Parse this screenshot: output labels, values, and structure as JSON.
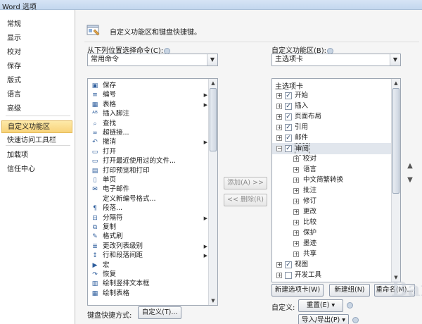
{
  "titlebar": {
    "title": "Word 选项",
    "ghost_left": "",
    "ghost_right": ""
  },
  "nav": {
    "items": [
      {
        "label": "常规"
      },
      {
        "label": "显示"
      },
      {
        "label": "校对"
      },
      {
        "label": "保存"
      },
      {
        "label": "版式"
      },
      {
        "label": "语言"
      },
      {
        "label": "高级"
      },
      {
        "label": "自定义功能区"
      },
      {
        "label": "快速访问工具栏"
      },
      {
        "label": "加载项"
      },
      {
        "label": "信任中心"
      }
    ]
  },
  "header": {
    "text": "自定义功能区和键盘快捷键。"
  },
  "left": {
    "label": "从下列位置选择命令(C):",
    "dropdown_value": "常用命令",
    "commands": [
      {
        "label": "保存",
        "icon": "save-icon",
        "glyph": "▣",
        "submenu": false
      },
      {
        "label": "编号",
        "icon": "numbering-icon",
        "glyph": "≡",
        "submenu": true
      },
      {
        "label": "表格",
        "icon": "table-icon",
        "glyph": "▦",
        "submenu": true
      },
      {
        "label": "插入脚注",
        "icon": "footnote-icon",
        "glyph": "ᴬᴮ",
        "submenu": false
      },
      {
        "label": "查找",
        "icon": "find-icon",
        "glyph": "⌕",
        "submenu": false
      },
      {
        "label": "超链接...",
        "icon": "hyperlink-icon",
        "glyph": "∞",
        "submenu": false
      },
      {
        "label": "撤消",
        "icon": "undo-icon",
        "glyph": "↶",
        "submenu": true
      },
      {
        "label": "打开",
        "icon": "open-icon",
        "glyph": "▭",
        "submenu": false
      },
      {
        "label": "打开最近使用过的文件...",
        "icon": "recent-file-icon",
        "glyph": "▭",
        "submenu": false
      },
      {
        "label": "打印预览和打印",
        "icon": "print-preview-icon",
        "glyph": "▤",
        "submenu": false
      },
      {
        "label": "单页",
        "icon": "single-page-icon",
        "glyph": "▯",
        "submenu": false
      },
      {
        "label": "电子邮件",
        "icon": "email-icon",
        "glyph": "✉",
        "submenu": false
      },
      {
        "label": "定义新编号格式...",
        "icon": "",
        "glyph": "",
        "submenu": false
      },
      {
        "label": "段落...",
        "icon": "paragraph-icon",
        "glyph": "¶",
        "submenu": false
      },
      {
        "label": "分隔符",
        "icon": "separator-icon",
        "glyph": "⊟",
        "submenu": true
      },
      {
        "label": "复制",
        "icon": "copy-icon",
        "glyph": "⧉",
        "submenu": false
      },
      {
        "label": "格式刷",
        "icon": "format-painter-icon",
        "glyph": "✎",
        "submenu": false
      },
      {
        "label": "更改列表级别",
        "icon": "list-level-icon",
        "glyph": "≣",
        "submenu": true
      },
      {
        "label": "行和段落间距",
        "icon": "line-spacing-icon",
        "glyph": "↕",
        "submenu": true
      },
      {
        "label": "宏",
        "icon": "macro-icon",
        "glyph": "▶",
        "submenu": false
      },
      {
        "label": "恢复",
        "icon": "redo-icon",
        "glyph": "↷",
        "submenu": false
      },
      {
        "label": "绘制竖排文本框",
        "icon": "vertical-textbox-icon",
        "glyph": "▥",
        "submenu": false
      },
      {
        "label": "绘制表格",
        "icon": "draw-table-icon",
        "glyph": "▦",
        "submenu": false
      }
    ]
  },
  "middle": {
    "add_label": "添加(A) >>",
    "remove_label": "<< 删除(R)"
  },
  "right": {
    "label": "自定义功能区(B):",
    "dropdown_value": "主选项卡",
    "tree_header": "主选项卡",
    "tree": [
      {
        "label": "开始",
        "level": 0,
        "expander": "+",
        "checkbox": true,
        "checked": true
      },
      {
        "label": "插入",
        "level": 0,
        "expander": "+",
        "checkbox": true,
        "checked": true
      },
      {
        "label": "页面布局",
        "level": 0,
        "expander": "+",
        "checkbox": true,
        "checked": true
      },
      {
        "label": "引用",
        "level": 0,
        "expander": "+",
        "checkbox": true,
        "checked": true
      },
      {
        "label": "邮件",
        "level": 0,
        "expander": "+",
        "checkbox": true,
        "checked": true
      },
      {
        "label": "审阅",
        "level": 0,
        "expander": "−",
        "checkbox": true,
        "checked": true,
        "selected": true
      },
      {
        "label": "校对",
        "level": 1,
        "expander": "+",
        "checkbox": false
      },
      {
        "label": "语言",
        "level": 1,
        "expander": "+",
        "checkbox": false
      },
      {
        "label": "中文简繁转换",
        "level": 1,
        "expander": "+",
        "checkbox": false
      },
      {
        "label": "批注",
        "level": 1,
        "expander": "+",
        "checkbox": false
      },
      {
        "label": "修订",
        "level": 1,
        "expander": "+",
        "checkbox": false
      },
      {
        "label": "更改",
        "level": 1,
        "expander": "+",
        "checkbox": false
      },
      {
        "label": "比较",
        "level": 1,
        "expander": "+",
        "checkbox": false
      },
      {
        "label": "保护",
        "level": 1,
        "expander": "+",
        "checkbox": false
      },
      {
        "label": "墨迹",
        "level": 1,
        "expander": "+",
        "checkbox": false
      },
      {
        "label": "共享",
        "level": 1,
        "expander": "+",
        "checkbox": false
      },
      {
        "label": "视图",
        "level": 0,
        "expander": "+",
        "checkbox": true,
        "checked": true
      },
      {
        "label": "开发工具",
        "level": 0,
        "expander": "+",
        "checkbox": true,
        "checked": false
      }
    ],
    "new_tab_label": "新建选项卡(W)",
    "new_group_label": "新建组(N)",
    "rename_label": "重命名(M)...",
    "custom_label": "自定义:",
    "reset_label": "重置(E)",
    "reset_arrow": "▾",
    "import_export_label": "导入/导出(P)",
    "import_export_arrow": "▾"
  },
  "keyboard": {
    "label": "键盘快捷方式:",
    "button": "自定义(T)..."
  },
  "watermark": "Baidu"
}
